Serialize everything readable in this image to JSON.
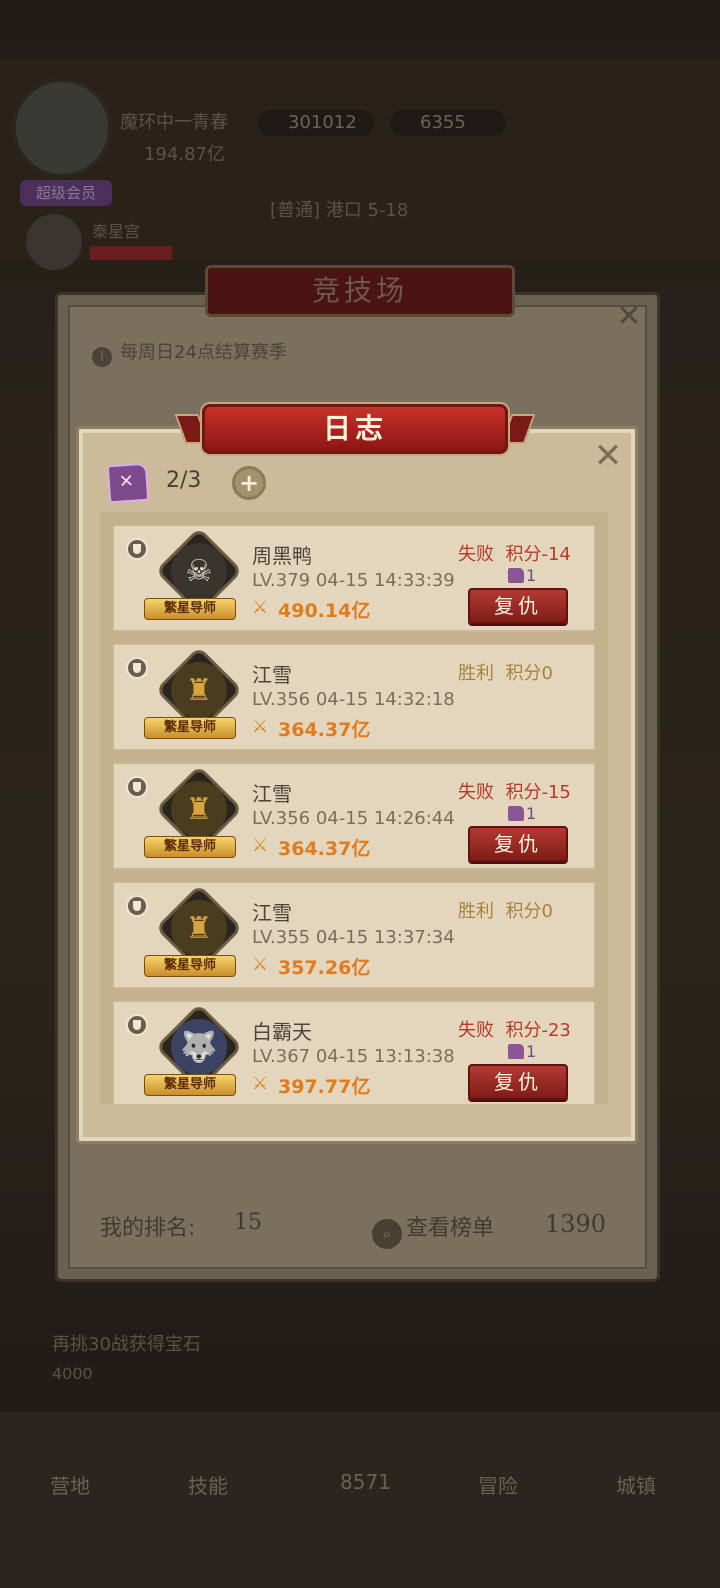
{
  "background": {
    "player_name": "魔环中一青春",
    "player_power": "194.87亿",
    "gem_count": "301012",
    "coin_count": "6355",
    "vip_badge": "超级会员",
    "companion_name": "泰星宫",
    "stage_label": "[普通] 港口 5-18",
    "bottom_resource_label": "再挑30战获得宝石",
    "bottom_resource_amount": "4000",
    "nav": [
      {
        "label": "营地"
      },
      {
        "label": "技能"
      },
      {
        "label": "8571"
      },
      {
        "label": "冒险"
      },
      {
        "label": "城镇"
      }
    ]
  },
  "arena": {
    "title": "竞技场",
    "notice": "每周日24点结算赛季",
    "my_rank_label": "我的排名:",
    "my_rank_value": "15",
    "view_rank_label": "查看榜单",
    "score": "1390"
  },
  "log_modal": {
    "title": "日志",
    "tickets": "2/3",
    "add_label": "+",
    "entries": [
      {
        "name": "周黑鸭",
        "level_time": "LV.379 04-15 14:33:39",
        "power": "490.14亿",
        "result": "失败",
        "points": "积分-14",
        "ticket_gain": "1",
        "has_revenge": true,
        "badge": "繁星导师",
        "avatar": "skull"
      },
      {
        "name": "江雪",
        "level_time": "LV.356 04-15 14:32:18",
        "power": "364.37亿",
        "result": "胜利",
        "points": "积分0",
        "ticket_gain": "",
        "has_revenge": false,
        "badge": "繁星导师",
        "avatar": "hood"
      },
      {
        "name": "江雪",
        "level_time": "LV.356 04-15 14:26:44",
        "power": "364.37亿",
        "result": "失败",
        "points": "积分-15",
        "ticket_gain": "1",
        "has_revenge": true,
        "badge": "繁星导师",
        "avatar": "hood"
      },
      {
        "name": "江雪",
        "level_time": "LV.355 04-15 13:37:34",
        "power": "357.26亿",
        "result": "胜利",
        "points": "积分0",
        "ticket_gain": "",
        "has_revenge": false,
        "badge": "繁星导师",
        "avatar": "hood"
      },
      {
        "name": "白霸天",
        "level_time": "LV.367 04-15 13:13:38",
        "power": "397.77亿",
        "result": "失败",
        "points": "积分-23",
        "ticket_gain": "1",
        "has_revenge": true,
        "badge": "繁星导师",
        "avatar": "wolf"
      }
    ],
    "revenge_label": "复仇"
  },
  "colors": {
    "loss": "#b8392a",
    "win": "#a78240",
    "power": "#e07b1e",
    "banner": "#c9312a"
  }
}
